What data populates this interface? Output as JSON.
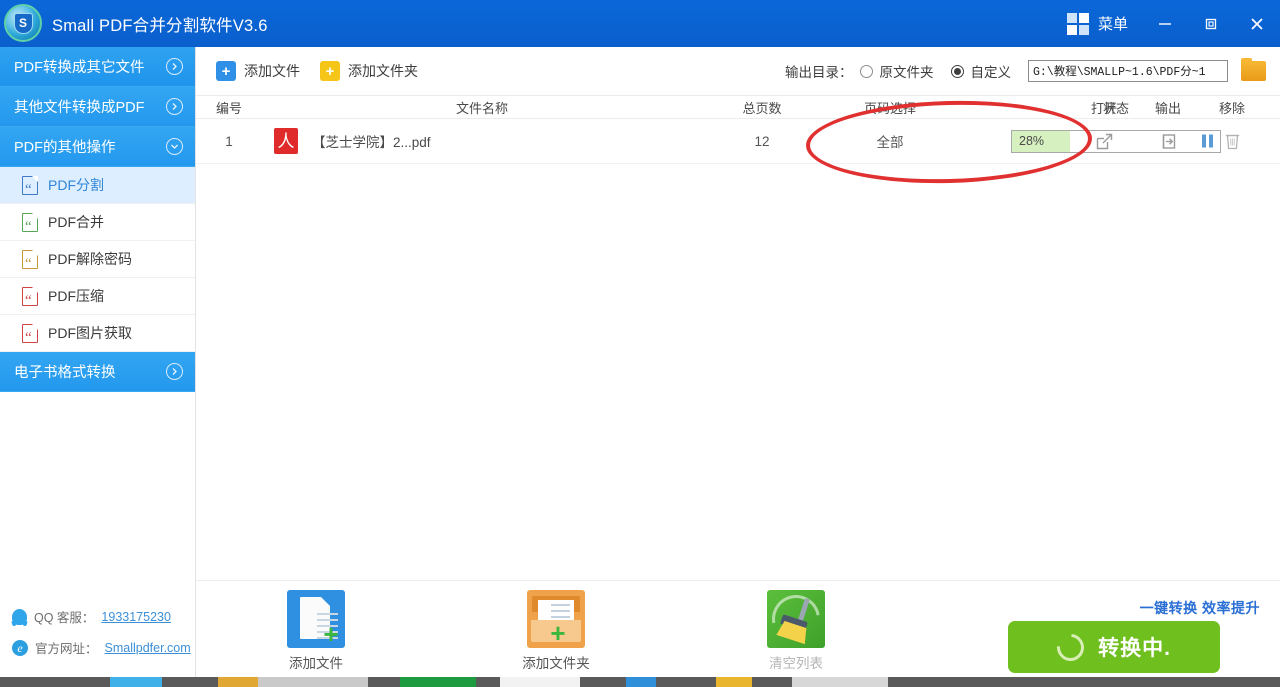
{
  "window": {
    "title": "Small PDF合并分割软件V3.6",
    "logo_letter": "S",
    "menu_label": "菜单",
    "minimize_icon": "minimize-icon",
    "maximize_icon": "maximize-icon",
    "close_icon": "close-icon"
  },
  "sidebar": {
    "groups": [
      {
        "label": "PDF转换成其它文件",
        "expanded": false
      },
      {
        "label": "其他文件转换成PDF",
        "expanded": false
      },
      {
        "label": "PDF的其他操作",
        "expanded": true
      },
      {
        "label": "电子书格式转换",
        "expanded": false
      }
    ],
    "items": [
      {
        "label": "PDF分割",
        "active": true,
        "icon_color": "#3f79c4"
      },
      {
        "label": "PDF合并",
        "active": false,
        "icon_color": "#56a456"
      },
      {
        "label": "PDF解除密码",
        "active": false,
        "icon_color": "#c69a3c"
      },
      {
        "label": "PDF压缩",
        "active": false,
        "icon_color": "#cf4545"
      },
      {
        "label": "PDF图片获取",
        "active": false,
        "icon_color": "#cf4545"
      }
    ],
    "contact": {
      "qq_label": "QQ 客服：",
      "qq_value": "1933175230",
      "site_label": "官方网址：",
      "site_value": "Smallpdfer.com"
    }
  },
  "toolbar": {
    "add_file": "添加文件",
    "add_folder": "添加文件夹",
    "output_dir_label": "输出目录：",
    "option_source": "原文件夹",
    "option_custom": "自定义",
    "selected_option": "自定义",
    "path_value": "G:\\教程\\SMALLP~1.6\\PDF分~1",
    "browse_icon": "folder-icon"
  },
  "table": {
    "headers": {
      "num": "编号",
      "name": "文件名称",
      "pages": "总页数",
      "selection": "页码选择",
      "status": "状态",
      "open": "打开",
      "export": "输出",
      "remove": "移除"
    },
    "rows": [
      {
        "num": "1",
        "name": "【芝士学院】2...pdf",
        "pages": "12",
        "selection": "全部",
        "progress_label": "28%",
        "progress_percent": 28,
        "state_icon": "pause-icon"
      }
    ]
  },
  "bottom": {
    "actions": [
      {
        "label": "添加文件",
        "icon": "add-file-icon",
        "disabled": false
      },
      {
        "label": "添加文件夹",
        "icon": "add-folder-icon",
        "disabled": false
      },
      {
        "label": "清空列表",
        "icon": "clear-list-icon",
        "disabled": true
      }
    ],
    "promo": "一键转换 效率提升",
    "convert_label": "转换中.",
    "convert_icon": "spinner-icon"
  },
  "colors": {
    "titlebar": "#0a63d2",
    "sidebar_header": "#2398ee",
    "active_item_bg": "#dceeff",
    "progress_fill": "#d7f0c0",
    "convert_button": "#6fc01f",
    "annotation": "#e13030"
  }
}
